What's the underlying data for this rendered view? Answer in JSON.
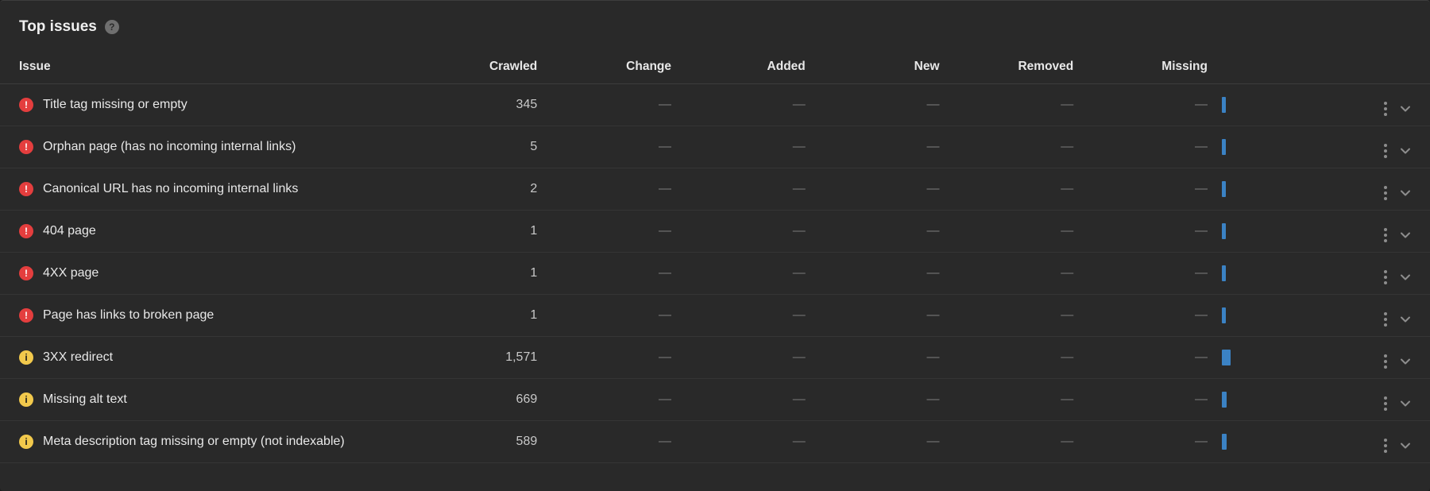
{
  "header": {
    "title": "Top issues",
    "help_glyph": "?"
  },
  "columns": {
    "issue": "Issue",
    "crawled": "Crawled",
    "change": "Change",
    "added": "Added",
    "new": "New",
    "removed": "Removed",
    "missing": "Missing"
  },
  "dash": "—",
  "badge_glyphs": {
    "error": "!",
    "warn": "i"
  },
  "rows": [
    {
      "severity": "error",
      "issue": "Title tag missing or empty",
      "crawled": "345",
      "change": "—",
      "added": "—",
      "new": "—",
      "removed": "—",
      "missing": "—",
      "bar_pct": 3
    },
    {
      "severity": "error",
      "issue": "Orphan page (has no incoming internal links)",
      "crawled": "5",
      "change": "—",
      "added": "—",
      "new": "—",
      "removed": "—",
      "missing": "—",
      "bar_pct": 3
    },
    {
      "severity": "error",
      "issue": "Canonical URL has no incoming internal links",
      "crawled": "2",
      "change": "—",
      "added": "—",
      "new": "—",
      "removed": "—",
      "missing": "—",
      "bar_pct": 3
    },
    {
      "severity": "error",
      "issue": "404 page",
      "crawled": "1",
      "change": "—",
      "added": "—",
      "new": "—",
      "removed": "—",
      "missing": "—",
      "bar_pct": 3
    },
    {
      "severity": "error",
      "issue": "4XX page",
      "crawled": "1",
      "change": "—",
      "added": "—",
      "new": "—",
      "removed": "—",
      "missing": "—",
      "bar_pct": 3
    },
    {
      "severity": "error",
      "issue": "Page has links to broken page",
      "crawled": "1",
      "change": "—",
      "added": "—",
      "new": "—",
      "removed": "—",
      "missing": "—",
      "bar_pct": 3
    },
    {
      "severity": "warn",
      "issue": "3XX redirect",
      "crawled": "1,571",
      "change": "—",
      "added": "—",
      "new": "—",
      "removed": "—",
      "missing": "—",
      "bar_pct": 7
    },
    {
      "severity": "warn",
      "issue": "Missing alt text",
      "crawled": "669",
      "change": "—",
      "added": "—",
      "new": "—",
      "removed": "—",
      "missing": "—",
      "bar_pct": 4
    },
    {
      "severity": "warn",
      "issue": "Meta description tag missing or empty (not indexable)",
      "crawled": "589",
      "change": "—",
      "added": "—",
      "new": "—",
      "removed": "—",
      "missing": "—",
      "bar_pct": 4
    }
  ]
}
